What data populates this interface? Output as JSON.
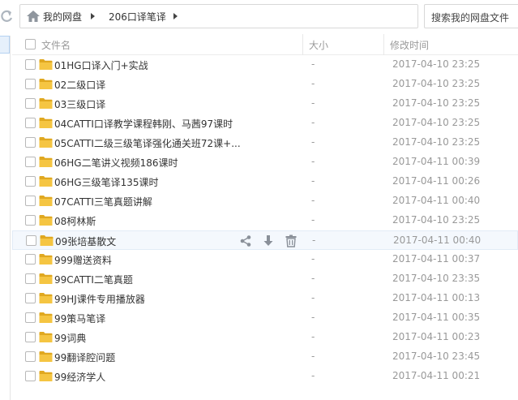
{
  "breadcrumb": {
    "items": [
      "我的网盘",
      "206口译笔译"
    ]
  },
  "search": {
    "label": "搜索我的网盘文件"
  },
  "header": {
    "name": "文件名",
    "size": "大小",
    "modified": "修改时间"
  },
  "files": [
    {
      "name": "01HG口译入门+实战",
      "size": "-",
      "modified": "2017-04-10 23:25"
    },
    {
      "name": "02二级口译",
      "size": "-",
      "modified": "2017-04-10 23:25"
    },
    {
      "name": "03三级口译",
      "size": "-",
      "modified": "2017-04-10 23:25"
    },
    {
      "name": "04CATTI口译教学课程韩刚、马茜97课时",
      "size": "-",
      "modified": "2017-04-10 23:25"
    },
    {
      "name": "05CATTI二级三级笔译强化通关班72课+...",
      "size": "-",
      "modified": "2017-04-10 23:25"
    },
    {
      "name": "06HG二笔讲义视频186课时",
      "size": "-",
      "modified": "2017-04-11 00:39"
    },
    {
      "name": "06HG三级笔译135课时",
      "size": "-",
      "modified": "2017-04-11 00:26"
    },
    {
      "name": "07CATTI三笔真题讲解",
      "size": "-",
      "modified": "2017-04-11 00:40"
    },
    {
      "name": "08柯林斯",
      "size": "-",
      "modified": "2017-04-10 23:25"
    },
    {
      "name": "09张培基散文",
      "size": "-",
      "modified": "2017-04-11 00:40"
    },
    {
      "name": "999赠送资料",
      "size": "-",
      "modified": "2017-04-11 00:37"
    },
    {
      "name": "99CATTI二笔真题",
      "size": "-",
      "modified": "2017-04-10 23:35"
    },
    {
      "name": "99HJ课件专用播放器",
      "size": "-",
      "modified": "2017-04-11 00:13"
    },
    {
      "name": "99策马笔译",
      "size": "-",
      "modified": "2017-04-11 00:35"
    },
    {
      "name": "99词典",
      "size": "-",
      "modified": "2017-04-11 00:23"
    },
    {
      "name": "99翻译腔问题",
      "size": "-",
      "modified": "2017-04-10 23:45"
    },
    {
      "name": "99经济学人",
      "size": "-",
      "modified": "2017-04-11 00:21"
    }
  ],
  "hover_row_index": 9,
  "row_actions": [
    "share-icon",
    "download-icon",
    "delete-icon"
  ],
  "icons": {
    "refresh": "refresh-icon",
    "home": "home-icon",
    "folder": "folder-icon"
  },
  "colors": {
    "folder": "#f5c542",
    "folder_dark": "#e0a820",
    "hover_bg": "#f4f8fd",
    "muted_text": "#999999",
    "icon_gray": "#8a9099"
  }
}
